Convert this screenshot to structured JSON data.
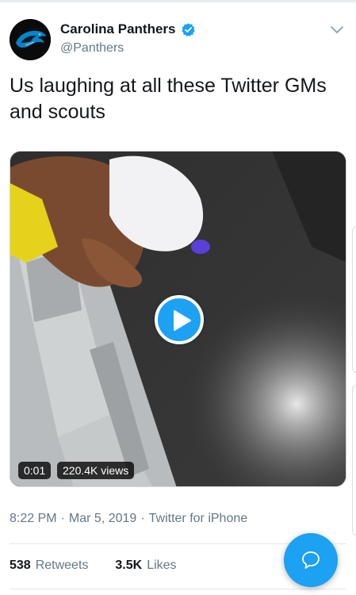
{
  "tweet": {
    "display_name": "Carolina Panthers",
    "handle": "@Panthers",
    "text": "Us laughing at all these Twitter GMs and scouts",
    "verified": true
  },
  "media": {
    "type": "video",
    "duration": "0:01",
    "views": "220.4K views"
  },
  "meta": {
    "time": "8:22 PM",
    "separator": "·",
    "date": "Mar 5, 2019",
    "source": "Twitter for iPhone"
  },
  "stats": {
    "retweets_count": "538",
    "retweets_label": "Retweets",
    "likes_count": "3.5K",
    "likes_label": "Likes"
  },
  "icons": {
    "avatar": "panther-logo-icon",
    "verified": "verified-badge-icon",
    "caret": "chevron-down-icon",
    "play": "play-icon",
    "compose": "reply-bubble-icon"
  },
  "colors": {
    "accent": "#1da1f2",
    "text": "#14171a",
    "secondary": "#657786"
  }
}
